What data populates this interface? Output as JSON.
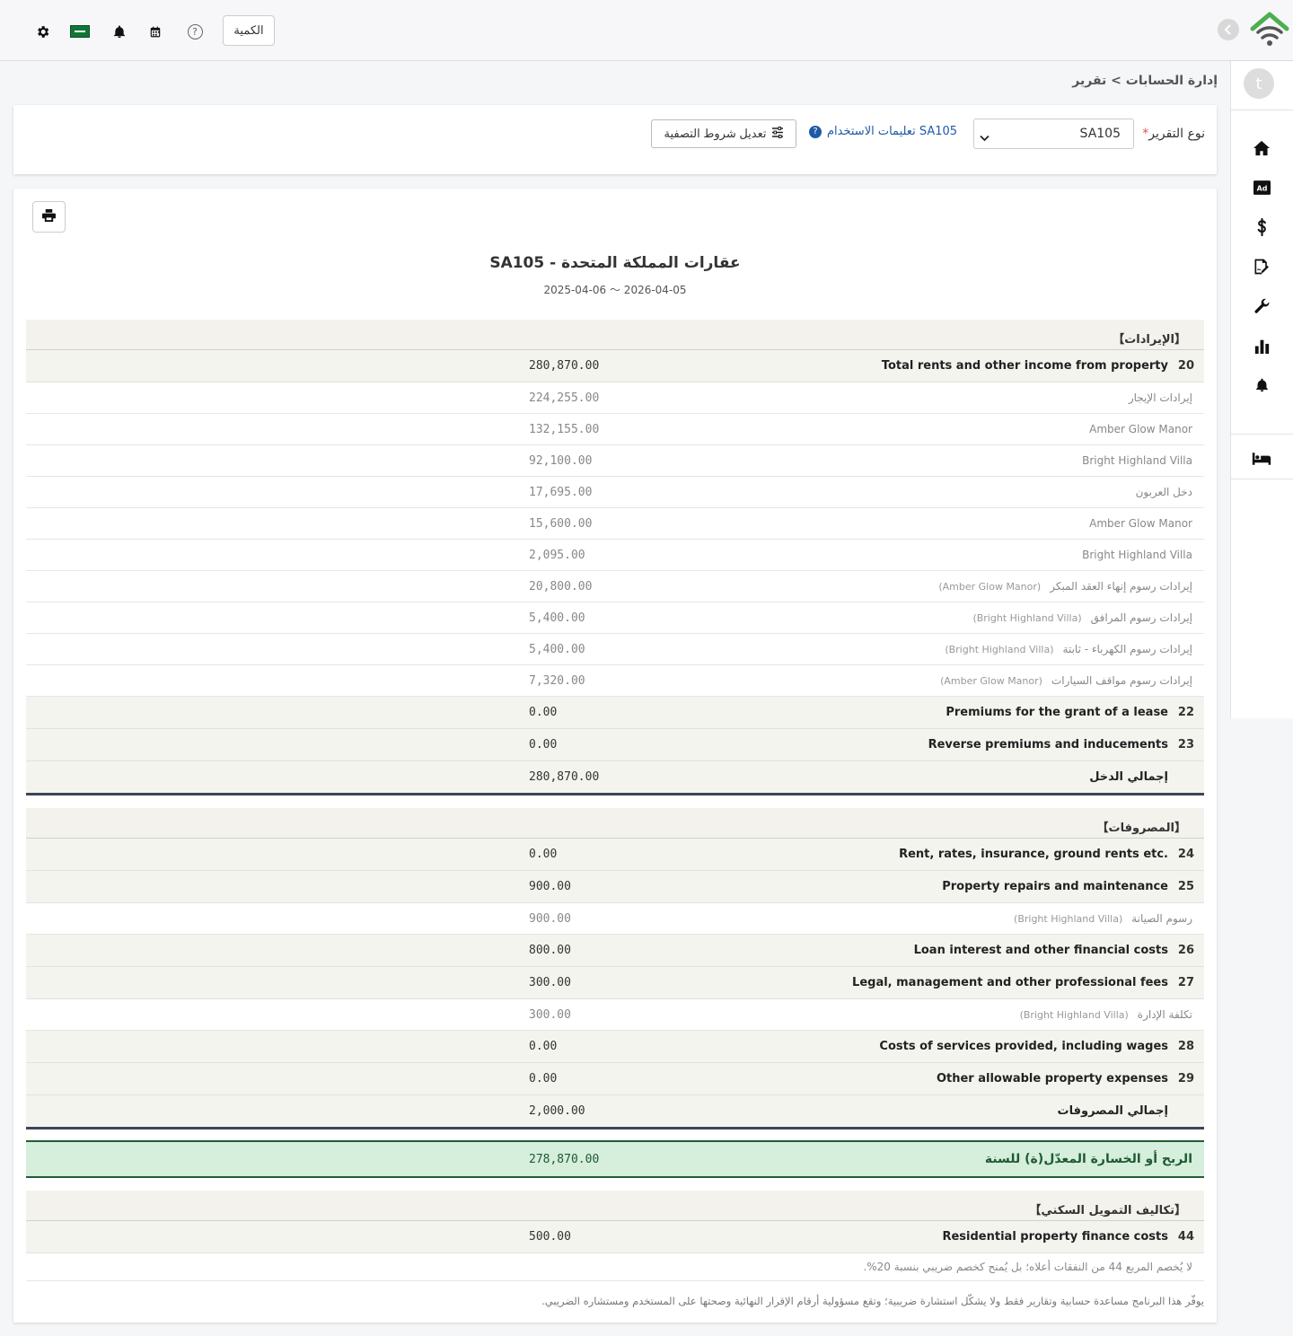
{
  "header": {
    "quantity_button": "الكمية",
    "help_icon_glyph": "?"
  },
  "sidebar": {
    "avatar_letter": "t",
    "items": [
      "home-icon",
      "ad-icon",
      "dollar-icon",
      "signature-icon",
      "wrench-icon",
      "bar-chart-icon",
      "bell-icon",
      "bed-icon"
    ]
  },
  "breadcrumb": "إدارة الحسابات > تقرير",
  "filter": {
    "report_type_label": "نوع التقرير",
    "required_mark": "*",
    "report_type_value": "SA105",
    "help_link": "تعليمات الاستخدام SA105",
    "edit_filters_button": "تعديل شروط التصفية"
  },
  "report": {
    "title": "SA105 - عقارات المملكة المتحدة",
    "date_range": "2025-04-06 〜 2026-04-05",
    "income": {
      "section_label": "【الإيرادات】",
      "lines": [
        {
          "num": "20",
          "label": "Total rents and other income from property",
          "amount": "280,870.00"
        },
        {
          "label": "إيرادات الإيجار",
          "prop": "",
          "amount": "224,255.00"
        },
        {
          "label": "Amber Glow Manor",
          "prop": "",
          "amount": "132,155.00"
        },
        {
          "label": "Bright Highland Villa",
          "prop": "",
          "amount": "92,100.00"
        },
        {
          "label": "دخل العربون",
          "prop": "",
          "amount": "17,695.00"
        },
        {
          "label": "Amber Glow Manor",
          "prop": "",
          "amount": "15,600.00"
        },
        {
          "label": "Bright Highland Villa",
          "prop": "",
          "amount": "2,095.00"
        },
        {
          "label": "إيرادات رسوم إنهاء العقد المبكر",
          "prop": "(Amber Glow Manor)",
          "amount": "20,800.00"
        },
        {
          "label": "إيرادات رسوم المرافق",
          "prop": "(Bright Highland Villa)",
          "amount": "5,400.00"
        },
        {
          "label": "إيرادات رسوم الكهرباء - ثابتة",
          "prop": "(Bright Highland Villa)",
          "amount": "5,400.00"
        },
        {
          "label": "إيرادات رسوم مواقف السيارات",
          "prop": "(Amber Glow Manor)",
          "amount": "7,320.00"
        },
        {
          "num": "22",
          "label": "Premiums for the grant of a lease",
          "amount": "0.00"
        },
        {
          "num": "23",
          "label": "Reverse premiums and inducements",
          "amount": "0.00"
        }
      ],
      "total_label": "إجمالي الدخل",
      "total_amount": "280,870.00"
    },
    "expenses": {
      "section_label": "【المصروفات】",
      "lines": [
        {
          "num": "24",
          "label": "Rent, rates, insurance, ground rents etc.",
          "amount": "0.00"
        },
        {
          "num": "25",
          "label": "Property repairs and maintenance",
          "amount": "900.00"
        },
        {
          "label": "رسوم الصيانة",
          "prop": "(Bright Highland Villa)",
          "amount": "900.00"
        },
        {
          "num": "26",
          "label": "Loan interest and other financial costs",
          "amount": "800.00"
        },
        {
          "num": "27",
          "label": "Legal, management and other professional fees",
          "amount": "300.00"
        },
        {
          "label": "تكلفة الإدارة",
          "prop": "(Bright Highland Villa)",
          "amount": "300.00"
        },
        {
          "num": "28",
          "label": "Costs of services provided, including wages",
          "amount": "0.00"
        },
        {
          "num": "29",
          "label": "Other allowable property expenses",
          "amount": "0.00"
        }
      ],
      "total_label": "إجمالي المصروفات",
      "total_amount": "2,000.00"
    },
    "profit_label": "الربح أو الخسارة المعدّل(ة) للسنة",
    "profit_amount": "278,870.00",
    "finance": {
      "section_label": "【تكاليف التمويل السكني】",
      "num": "44",
      "label": "Residential property finance costs",
      "amount": "500.00",
      "note": "لا يُخصم المربع 44 من النفقات أعلاه؛ بل يُمنح كخصم ضريبي بنسبة 20%."
    },
    "disclaimer": "يوفّر هذا البرنامج مساعدة حسابية وتقارير فقط ولا يشكّل استشارة ضريبية؛ وتقع مسؤولية أرقام الإقرار النهائية وصحتها على المستخدم ومستشاره الضريبي."
  },
  "colors": {
    "accent_link": "#1e5aa6",
    "profit_bg": "#d6eedc",
    "profit_text": "#1d5a33",
    "logo_green": "#4caf50"
  }
}
